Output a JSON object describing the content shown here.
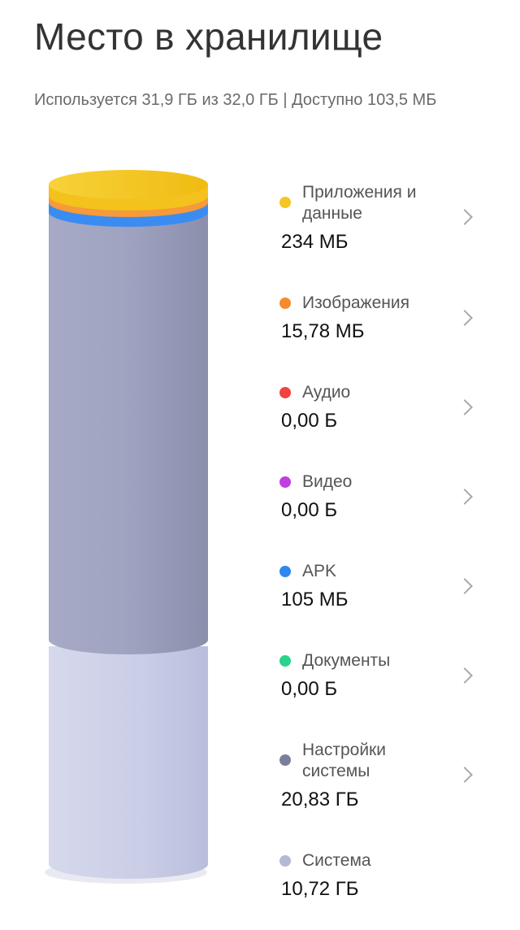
{
  "header": {
    "title": "Место в хранилище",
    "subtitle": "Используется 31,9 ГБ из 32,0 ГБ | Доступно 103,5 МБ"
  },
  "categories": [
    {
      "label": "Приложения и данные",
      "value": "234 МБ",
      "color": "#f5c623",
      "has_chevron": true
    },
    {
      "label": "Изображения",
      "value": "15,78 МБ",
      "color": "#f58b2c",
      "has_chevron": true
    },
    {
      "label": "Аудио",
      "value": "0,00 Б",
      "color": "#f0443e",
      "has_chevron": true
    },
    {
      "label": "Видео",
      "value": "0,00 Б",
      "color": "#c23ee0",
      "has_chevron": true
    },
    {
      "label": "APK",
      "value": "105 МБ",
      "color": "#2e86f0",
      "has_chevron": true
    },
    {
      "label": "Документы",
      "value": "0,00 Б",
      "color": "#2ad38b",
      "has_chevron": true
    },
    {
      "label": "Настройки системы",
      "value": "20,83 ГБ",
      "color": "#7b7f9e",
      "has_chevron": true
    },
    {
      "label": "Система",
      "value": "10,72 ГБ",
      "color": "#b3b8d6",
      "has_chevron": false
    }
  ],
  "colors": {
    "system_settings_fill": "#9a9fbd",
    "system_fill": "#cdd0e6"
  }
}
